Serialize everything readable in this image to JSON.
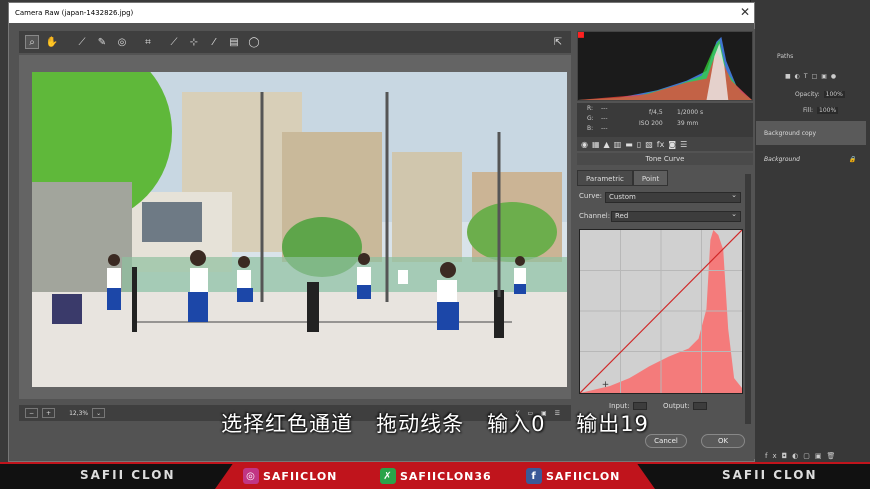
{
  "window": {
    "title": "Camera Raw (japan-1432826.jpg)"
  },
  "bottom": {
    "zoom": "12,3%"
  },
  "info": {
    "r_label": "R:",
    "g_label": "G:",
    "b_label": "B:",
    "r_val": "---",
    "g_val": "---",
    "b_val": "---",
    "aperture": "f/4,5",
    "shutter": "1/2000 s",
    "iso": "ISO 200",
    "focal": "39 mm"
  },
  "tone_curve": {
    "title": "Tone Curve",
    "tabs": [
      "Parametric",
      "Point"
    ],
    "curve_label": "Curve:",
    "curve_value": "Custom",
    "channel_label": "Channel:",
    "channel_value": "Red",
    "input_label": "Input:",
    "output_label": "Output:"
  },
  "buttons": {
    "cancel": "Cancel",
    "ok": "OK"
  },
  "photoshop": {
    "paths_tab": "Paths",
    "opacity_label": "Opacity:",
    "opacity_value": "100%",
    "fill_label": "Fill:",
    "fill_value": "100%",
    "layers": [
      "Background copy",
      "Background"
    ]
  },
  "subtitle": "选择红色通道   拖动线条   输入0    输出19",
  "banner": {
    "left_name": "SAFII CLON",
    "right_name": "SAFII CLON",
    "instagram": "SAFIICLON",
    "other": "SAFIICLON36",
    "facebook": "SAFIICLON"
  },
  "colors": {
    "accent_red": "#c0141c",
    "curve_fill": "#f47b7b",
    "curve_line": "#d02828"
  }
}
